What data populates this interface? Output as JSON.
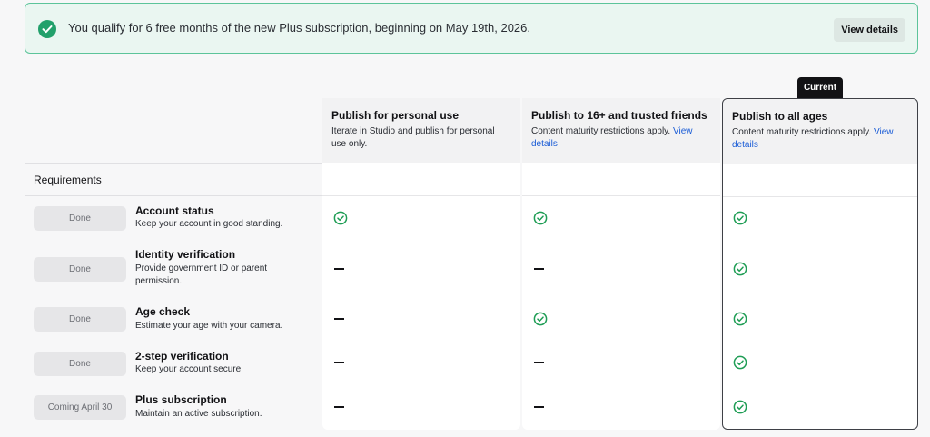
{
  "banner": {
    "message": "You qualify for 6 free months of the new Plus subscription, beginning on May 19th, 2026.",
    "button": "View details"
  },
  "current_tag": "Current",
  "columns": [
    {
      "title": "Publish for personal use",
      "desc": "Iterate in Studio and publish for personal use only.",
      "link": ""
    },
    {
      "title": "Publish to 16+ and trusted friends",
      "desc": "Content maturity restrictions apply.",
      "link": "View details"
    },
    {
      "title": "Publish to all ages",
      "desc": "Content maturity restrictions apply.",
      "link": "View details"
    }
  ],
  "requirements_label": "Requirements",
  "rows": [
    {
      "status": "Done",
      "name": "Account status",
      "desc": "Keep your account in good standing.",
      "cells": [
        "check",
        "check",
        "check"
      ]
    },
    {
      "status": "Done",
      "name": "Identity verification",
      "desc": "Provide government ID or parent permission.",
      "cells": [
        "dash",
        "dash",
        "check"
      ]
    },
    {
      "status": "Done",
      "name": "Age check",
      "desc": "Estimate your age with your camera.",
      "cells": [
        "dash",
        "check",
        "check"
      ]
    },
    {
      "status": "Done",
      "name": "2-step verification",
      "desc": "Keep your account secure.",
      "cells": [
        "dash",
        "dash",
        "check"
      ]
    },
    {
      "status": "Coming April 30",
      "name": "Plus subscription",
      "desc": "Maintain an active subscription.",
      "cells": [
        "dash",
        "dash",
        "check"
      ]
    }
  ],
  "colors": {
    "check": "#1f9d55",
    "banner_border": "#5cc49a",
    "link": "#1a5cd6"
  }
}
